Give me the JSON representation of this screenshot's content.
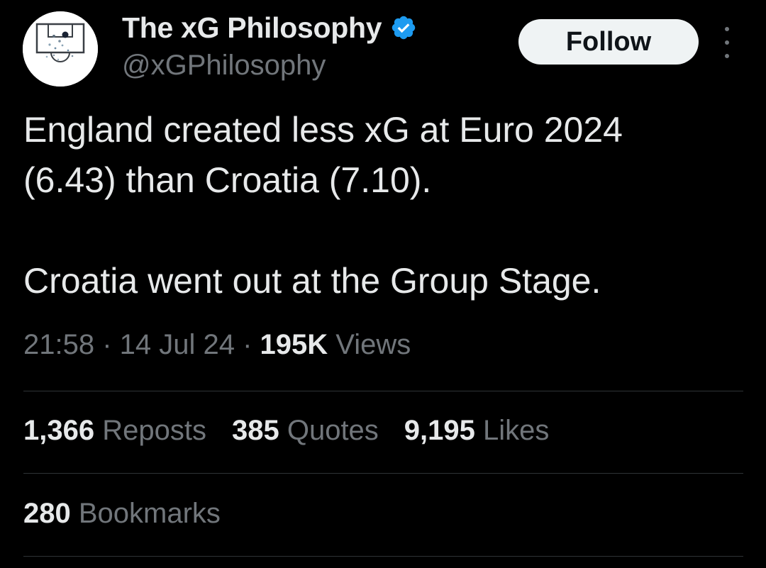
{
  "colors": {
    "background": "#000000",
    "primary_text": "#e7e9ea",
    "secondary_text": "#71767b",
    "verified_badge": "#1d9bf0",
    "follow_button_bg": "#eff3f4",
    "divider": "#2f3336"
  },
  "author": {
    "display_name": "The xG Philosophy",
    "handle": "@xGPhilosophy",
    "verified": true,
    "avatar_icon": "football-pitch-logo-icon"
  },
  "header": {
    "follow_label": "Follow",
    "more_icon": "more-vertical-icon"
  },
  "tweet": {
    "lines": [
      "England created less xG at Euro 2024",
      "(6.43) than Croatia (7.10).",
      "Croatia went out at the Group Stage."
    ]
  },
  "meta": {
    "time": "21:58",
    "separator": " · ",
    "date": "14 Jul 24",
    "views_count": "195K",
    "views_label": " Views"
  },
  "stats": {
    "reposts": {
      "count": "1,366",
      "label": " Reposts"
    },
    "quotes": {
      "count": "385",
      "label": " Quotes"
    },
    "likes": {
      "count": "9,195",
      "label": " Likes"
    },
    "bookmarks": {
      "count": "280",
      "label": " Bookmarks"
    }
  }
}
